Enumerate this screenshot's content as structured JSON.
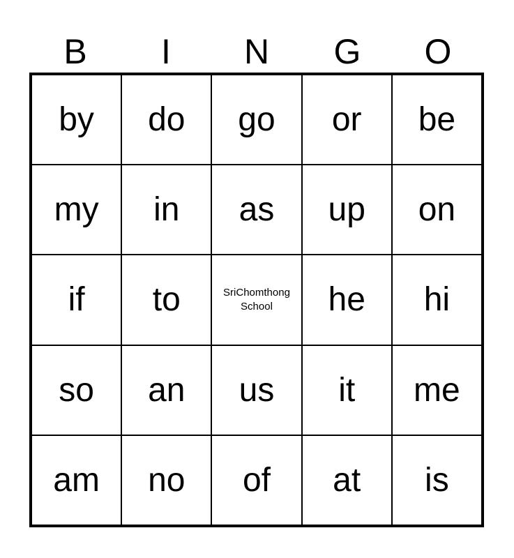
{
  "header": [
    "B",
    "I",
    "N",
    "G",
    "O"
  ],
  "board": [
    [
      "by",
      "do",
      "go",
      "or",
      "be"
    ],
    [
      "my",
      "in",
      "as",
      "up",
      "on"
    ],
    [
      "if",
      "to",
      "SriChomthong School",
      "he",
      "hi"
    ],
    [
      "so",
      "an",
      "us",
      "it",
      "me"
    ],
    [
      "am",
      "no",
      "of",
      "at",
      "is"
    ]
  ],
  "free_space": {
    "row": 2,
    "col": 2
  }
}
